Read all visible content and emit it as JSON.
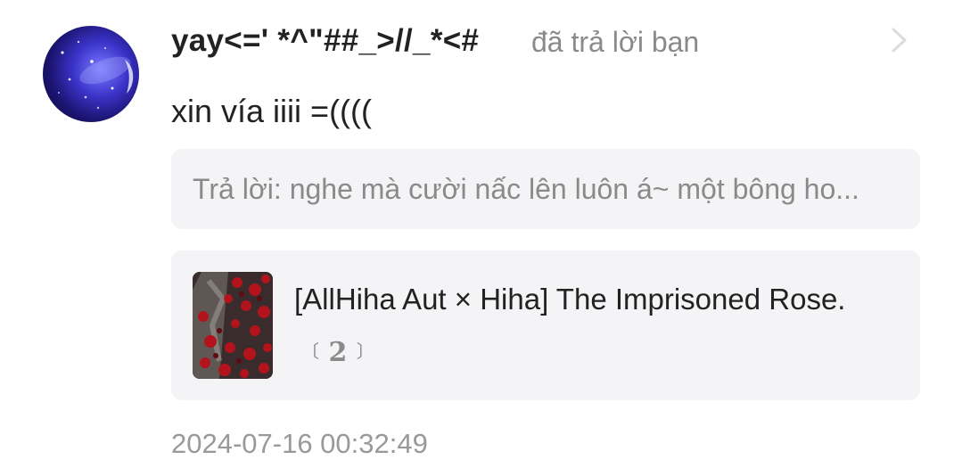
{
  "notification": {
    "username": "yay<=' *^\"##_>//_*<#",
    "action_text": "đã trả lời bạn",
    "comment": "xin vía iiii =((((",
    "reply_preview": "Trả lời: nghe mà cười nấc lên luôn á~ một bông ho...",
    "story": {
      "title": "[AllHiha Aut × Hiha] The Imprisoned Rose.",
      "chapter_open": "〔",
      "chapter": "2",
      "chapter_close": "〕"
    },
    "timestamp": "2024-07-16 00:32:49"
  },
  "icons": {
    "avatar": "avatar-galaxy-image",
    "chevron": "chevron-right-icon",
    "cover": "rose-cover-image"
  },
  "colors": {
    "text_primary": "#222222",
    "text_secondary": "#8a8a8a",
    "card_background": "#f4f4f6"
  }
}
